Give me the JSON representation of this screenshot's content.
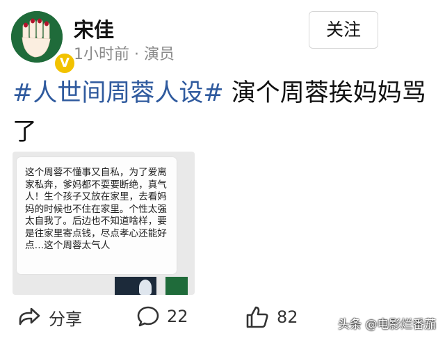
{
  "author": {
    "name": "宋佳",
    "meta": "1小时前 · 演员",
    "verified_badge": "V"
  },
  "follow_label": "关注",
  "post": {
    "hashtag": "#人世间周蓉人设#",
    "text": " 演个周蓉挨妈妈骂了"
  },
  "screenshot_image": {
    "comment_text": "这个周蓉不懂事又自私，为了爱离家私奔，爹妈都不耍要断绝，真气人！生个孩子又放在家里，去看妈妈的时候也不住在家里。个性太强太自我了。后边也不知道啥样，要是往家里寄点钱，尽点孝心还能好点…这个周蓉太气人"
  },
  "actions": {
    "share_label": "分享",
    "comments_count": "22",
    "likes_count": "82"
  },
  "watermark": "头条 @电影烂番茄",
  "colors": {
    "hashtag": "#2f5a9e",
    "verified": "#f2c200",
    "avatar_bg": "#1f6b3a"
  },
  "icons": {
    "share": "share-arrow-icon",
    "comment": "comment-bubble-icon",
    "like": "thumbs-up-icon",
    "verified": "verified-badge-icon"
  }
}
